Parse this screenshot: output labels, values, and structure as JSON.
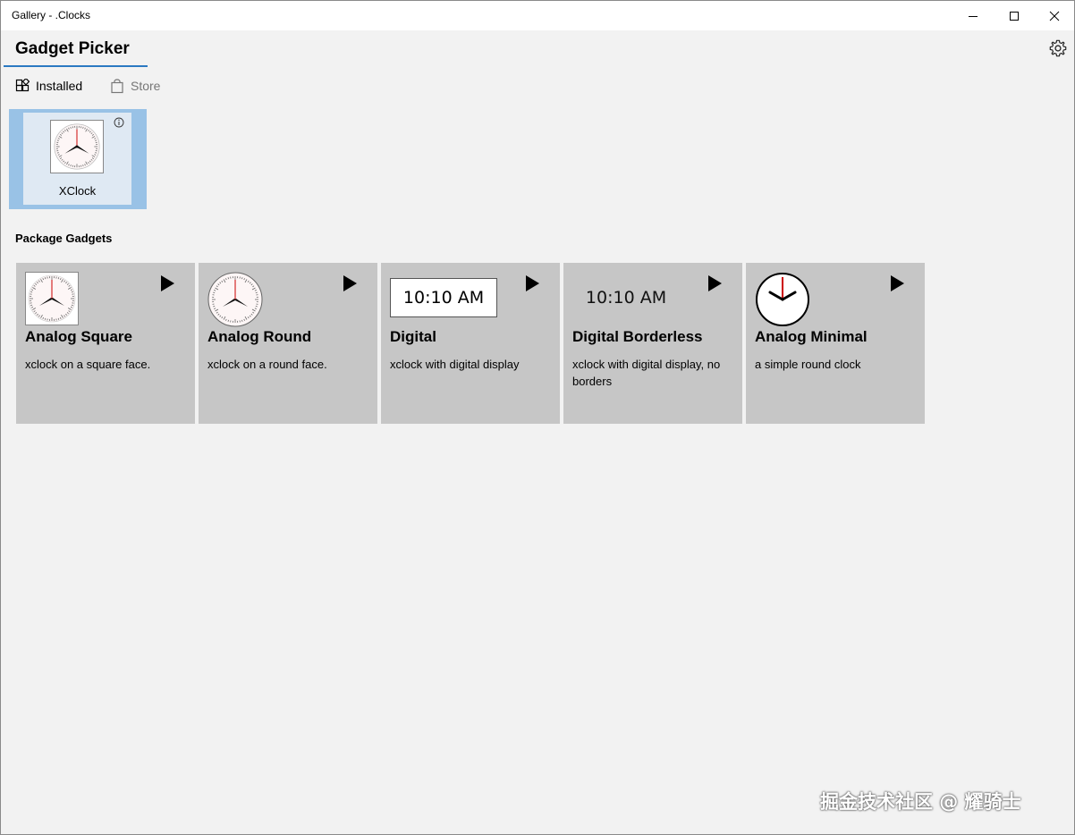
{
  "window": {
    "title": "Gallery - .Clocks",
    "minimize_icon": "minimize-icon",
    "maximize_icon": "maximize-icon",
    "close_icon": "close-icon"
  },
  "header": {
    "title": "Gadget Picker",
    "settings_icon": "gear-icon",
    "accent_color": "#2b79c2"
  },
  "tabs": [
    {
      "label": "Installed",
      "icon": "gadgets-grid-icon",
      "selected": true
    },
    {
      "label": "Store",
      "icon": "shopping-bag-icon",
      "selected": false
    }
  ],
  "installed": [
    {
      "name": "XClock",
      "icon": "analog-clock-icon",
      "info_icon": "info-icon",
      "selected": true
    }
  ],
  "package_section": {
    "label": "Package Gadgets",
    "gadgets": [
      {
        "name": "Analog Square",
        "description": "xclock on a square face.",
        "preview": "analog-square-clock"
      },
      {
        "name": "Analog Round",
        "description": "xclock on a round face.",
        "preview": "analog-round-clock"
      },
      {
        "name": "Digital",
        "description": "xclock with digital display",
        "preview_text": "10:10 AM"
      },
      {
        "name": "Digital Borderless",
        "description": "xclock with digital display, no borders",
        "preview_text": "10:10 AM"
      },
      {
        "name": "Analog Minimal",
        "description": "a simple round clock",
        "preview": "analog-minimal-clock"
      }
    ]
  },
  "watermark": "掘金技术社区 @ 耀骑士"
}
